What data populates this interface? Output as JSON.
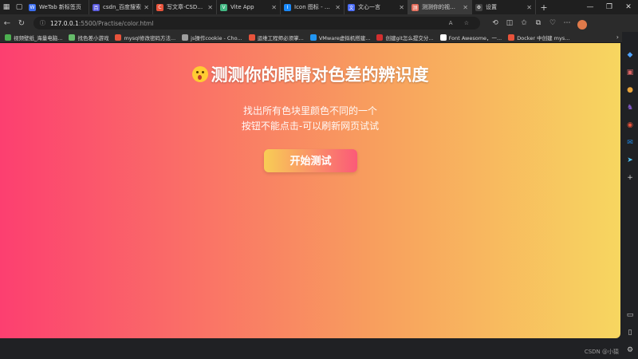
{
  "tabs": [
    {
      "label": "WeTab 新标签页",
      "icon": "wetab-icon",
      "color": "#3a6df0",
      "glyph": "W"
    },
    {
      "label": "csdn_百度搜索",
      "icon": "baidu-icon",
      "color": "#5b5bdf",
      "glyph": "百"
    },
    {
      "label": "写文章-CSDN创作中心",
      "icon": "csdn-icon",
      "color": "#e8533b",
      "glyph": "C"
    },
    {
      "label": "Vite App",
      "icon": "vite-icon",
      "color": "#42b883",
      "glyph": "V"
    },
    {
      "label": "Icon 图标 - Vant",
      "icon": "vant-icon",
      "color": "#1989fa",
      "glyph": "I"
    },
    {
      "label": "文心一言",
      "icon": "wenxin-icon",
      "color": "#4a6cf7",
      "glyph": "文"
    },
    {
      "label": "测测你的视力比",
      "icon": "page-icon",
      "color": "#e46c5a",
      "glyph": "测"
    },
    {
      "label": "设置",
      "icon": "gear-icon",
      "color": "#444444",
      "glyph": "⚙"
    }
  ],
  "address": {
    "host": "127.0.0.1",
    "path": ":5500/Practise/color.html",
    "info_icon": "ⓘ"
  },
  "bookmarks": [
    {
      "label": "视频壁纸_海量电脑...",
      "color": "#4caf50"
    },
    {
      "label": "找色差小游戏",
      "color": "#66bb6a"
    },
    {
      "label": "mysql修改密码方法...",
      "color": "#e8533b"
    },
    {
      "label": "js操作cookie - Cho...",
      "color": "#9e9e9e"
    },
    {
      "label": "运维工程师必须掌...",
      "color": "#e8533b"
    },
    {
      "label": "VMware虚拟机搭建...",
      "color": "#2196f3"
    },
    {
      "label": "创建git怎么提交分...",
      "color": "#d32f2f"
    },
    {
      "label": "Font Awesome，一...",
      "color": "#ffffff"
    },
    {
      "label": "Docker 中创建 mys...",
      "color": "#e8533b"
    }
  ],
  "page": {
    "title": "测测你的眼睛对色差的辨识度",
    "subtitle_line1": "找出所有色块里颜色不同的一个",
    "subtitle_line2": "按钮不能点击-可以刷新网页试试",
    "start_button": "开始测试"
  },
  "watermark": "CSDN @小猿",
  "colors": {
    "gradient_start": "#fc3f70",
    "gradient_mid": "#f89e5e",
    "gradient_end": "#f7d660"
  }
}
